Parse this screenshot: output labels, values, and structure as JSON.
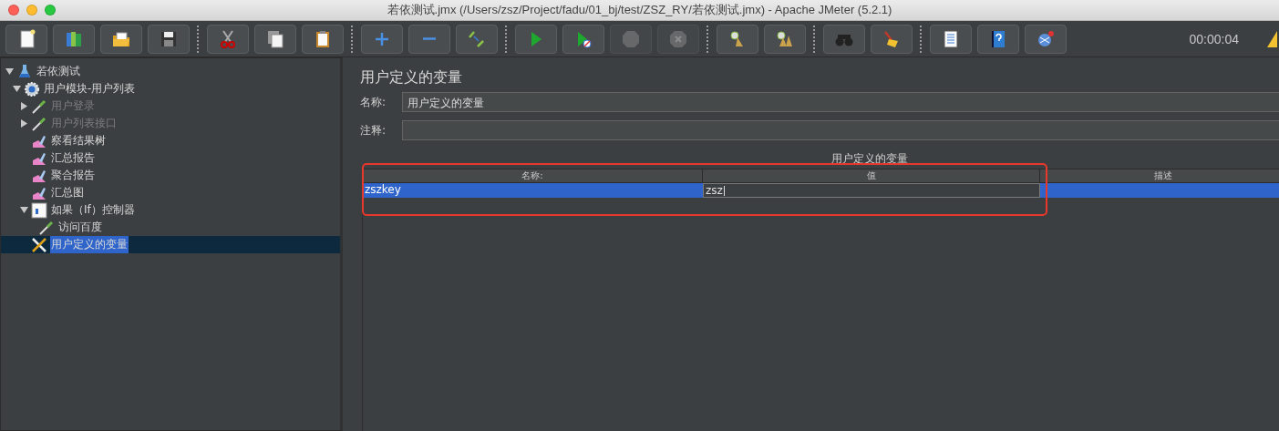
{
  "window": {
    "title": "若依测试.jmx (/Users/zsz/Project/fadu/01_bj/test/ZSZ_RY/若依测试.jmx) - Apache JMeter (5.2.1)"
  },
  "toolbar": {
    "groups": [
      [
        {
          "kind": "new",
          "disabled": false
        },
        {
          "kind": "templates",
          "disabled": false
        },
        {
          "kind": "open",
          "disabled": false
        },
        {
          "kind": "save",
          "disabled": false
        }
      ],
      [
        {
          "kind": "cut",
          "disabled": false
        },
        {
          "kind": "copy",
          "disabled": false
        },
        {
          "kind": "paste",
          "disabled": false
        }
      ],
      [
        {
          "kind": "expand",
          "disabled": false
        },
        {
          "kind": "collapse",
          "disabled": false
        },
        {
          "kind": "toggle",
          "disabled": false
        }
      ],
      [
        {
          "kind": "start",
          "disabled": false
        },
        {
          "kind": "start-no-pause",
          "disabled": false
        },
        {
          "kind": "stop",
          "disabled": true
        },
        {
          "kind": "shutdown",
          "disabled": true
        }
      ],
      [
        {
          "kind": "clear",
          "disabled": false
        },
        {
          "kind": "clear-all",
          "disabled": false
        }
      ],
      [
        {
          "kind": "search",
          "disabled": false
        },
        {
          "kind": "reset-search",
          "disabled": false
        }
      ],
      [
        {
          "kind": "functions",
          "disabled": false
        },
        {
          "kind": "help",
          "disabled": false
        },
        {
          "kind": "remote",
          "disabled": false
        }
      ]
    ],
    "timer": "00:00:04",
    "warning": true
  },
  "tree": [
    {
      "label": "若依测试",
      "kind": "test-plan",
      "expanded": true,
      "disabled": false,
      "selected": false,
      "children": [
        {
          "label": "用户模块-用户列表",
          "kind": "thread-group",
          "expanded": true,
          "disabled": false,
          "selected": false,
          "children": [
            {
              "label": "用户登录",
              "kind": "sampler",
              "expanded": false,
              "disabled": true,
              "selected": false
            },
            {
              "label": "用户列表接口",
              "kind": "sampler",
              "expanded": false,
              "disabled": true,
              "selected": false
            },
            {
              "label": "察看结果树",
              "kind": "listener",
              "disabled": false,
              "selected": false
            },
            {
              "label": "汇总报告",
              "kind": "listener",
              "disabled": false,
              "selected": false
            },
            {
              "label": "聚合报告",
              "kind": "listener",
              "disabled": false,
              "selected": false
            },
            {
              "label": "汇总图",
              "kind": "listener",
              "disabled": false,
              "selected": false
            },
            {
              "label": "如果（If）控制器",
              "kind": "controller",
              "expanded": true,
              "disabled": false,
              "selected": false,
              "children": [
                {
                  "label": "访问百度",
                  "kind": "sampler",
                  "disabled": false,
                  "selected": false
                }
              ]
            },
            {
              "label": "用户定义的变量",
              "kind": "config",
              "disabled": false,
              "selected": true
            }
          ]
        }
      ]
    }
  ],
  "panel": {
    "title": "用户定义的变量",
    "name_field": {
      "label": "名称:",
      "value": "用户定义的变量"
    },
    "comment_field": {
      "label": "注释:"
    },
    "table": {
      "title": "用户定义的变量",
      "highlighted": true,
      "columns": [
        "名称:",
        "值",
        "描述"
      ],
      "rows": [
        {
          "cells": [
            {
              "text": "zszkey",
              "editing": false
            },
            {
              "text": "zsz",
              "editing": true
            },
            {
              "editing": false
            }
          ],
          "selected": true
        }
      ]
    }
  }
}
